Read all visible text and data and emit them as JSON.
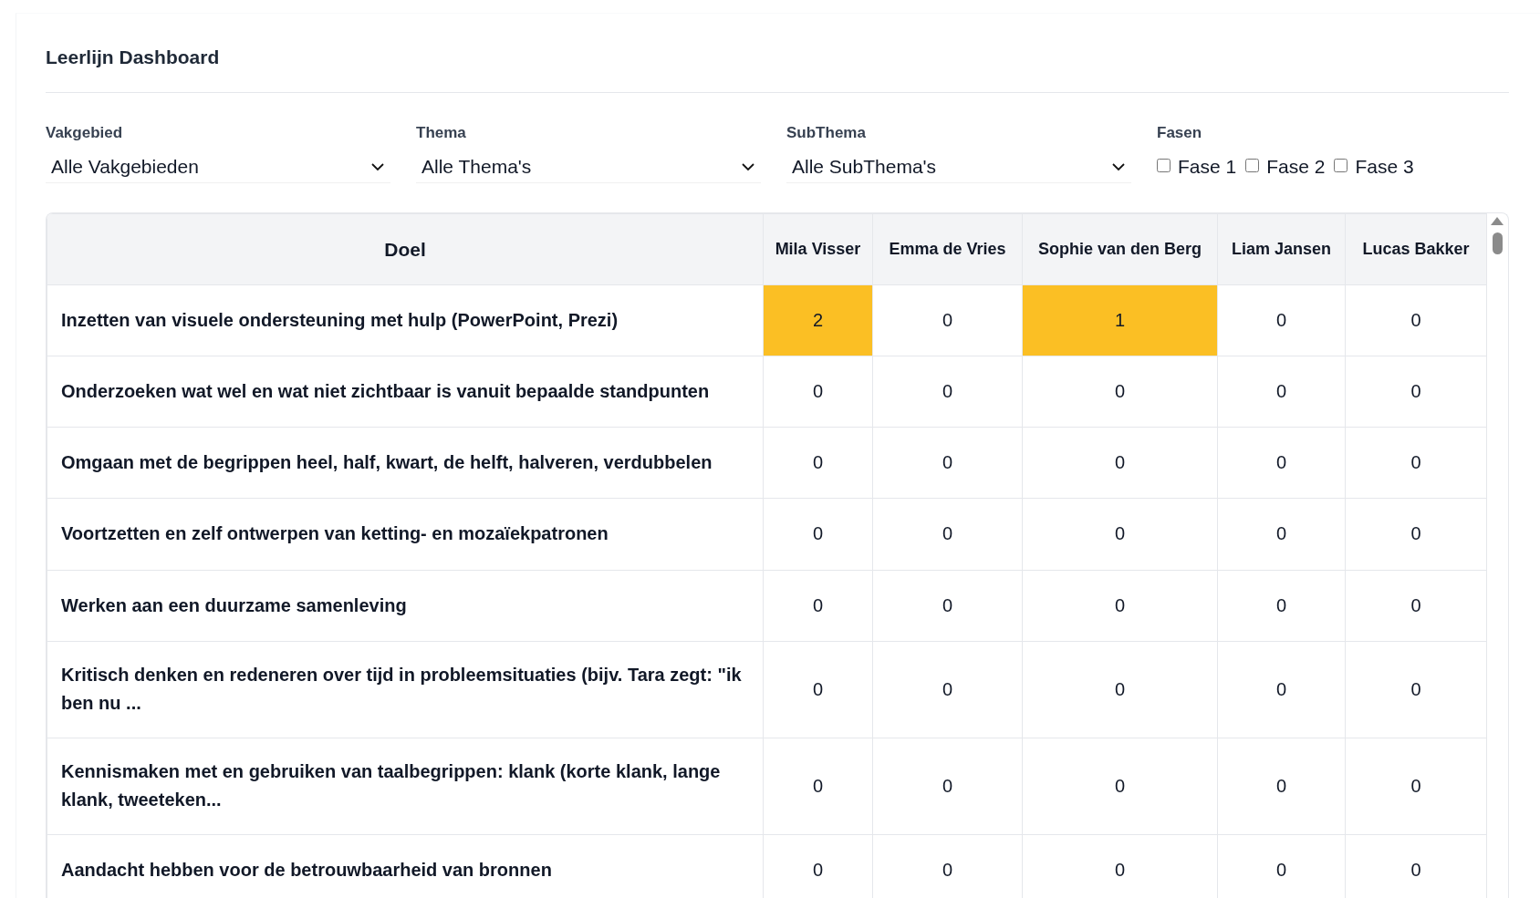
{
  "title": "Leerlijn Dashboard",
  "filters": [
    {
      "label": "Vakgebied",
      "value": "Alle Vakgebieden"
    },
    {
      "label": "Thema",
      "value": "Alle Thema's"
    },
    {
      "label": "SubThema",
      "value": "Alle SubThema's"
    }
  ],
  "phases": {
    "label": "Fasen",
    "options": [
      {
        "label": "Fase 1",
        "checked": false
      },
      {
        "label": "Fase 2",
        "checked": false
      },
      {
        "label": "Fase 3",
        "checked": false
      }
    ]
  },
  "table": {
    "columns": [
      "Doel",
      "Mila Visser",
      "Emma de Vries",
      "Sophie van den Berg",
      "Liam Jansen",
      "Lucas Bakker"
    ],
    "rows": [
      {
        "goal": "Inzetten van visuele ondersteuning met hulp (PowerPoint, Prezi)",
        "scores": [
          {
            "value": "2",
            "highlighted": true
          },
          {
            "value": "0",
            "highlighted": false
          },
          {
            "value": "1",
            "highlighted": true
          },
          {
            "value": "0",
            "highlighted": false
          },
          {
            "value": "0",
            "highlighted": false
          }
        ]
      },
      {
        "goal": "Onderzoeken wat wel en wat niet zichtbaar is vanuit bepaalde standpunten",
        "scores": [
          {
            "value": "0",
            "highlighted": false
          },
          {
            "value": "0",
            "highlighted": false
          },
          {
            "value": "0",
            "highlighted": false
          },
          {
            "value": "0",
            "highlighted": false
          },
          {
            "value": "0",
            "highlighted": false
          }
        ]
      },
      {
        "goal": "Omgaan met de begrippen heel, half, kwart, de helft, halveren, verdubbelen",
        "scores": [
          {
            "value": "0",
            "highlighted": false
          },
          {
            "value": "0",
            "highlighted": false
          },
          {
            "value": "0",
            "highlighted": false
          },
          {
            "value": "0",
            "highlighted": false
          },
          {
            "value": "0",
            "highlighted": false
          }
        ]
      },
      {
        "goal": "Voortzetten en zelf ontwerpen van ketting- en mozaïekpatronen",
        "scores": [
          {
            "value": "0",
            "highlighted": false
          },
          {
            "value": "0",
            "highlighted": false
          },
          {
            "value": "0",
            "highlighted": false
          },
          {
            "value": "0",
            "highlighted": false
          },
          {
            "value": "0",
            "highlighted": false
          }
        ]
      },
      {
        "goal": "Werken aan een duurzame samenleving",
        "scores": [
          {
            "value": "0",
            "highlighted": false
          },
          {
            "value": "0",
            "highlighted": false
          },
          {
            "value": "0",
            "highlighted": false
          },
          {
            "value": "0",
            "highlighted": false
          },
          {
            "value": "0",
            "highlighted": false
          }
        ]
      },
      {
        "goal": "Kritisch denken en redeneren over tijd in probleemsituaties (bijv. Tara zegt: \"ik ben nu ...",
        "scores": [
          {
            "value": "0",
            "highlighted": false
          },
          {
            "value": "0",
            "highlighted": false
          },
          {
            "value": "0",
            "highlighted": false
          },
          {
            "value": "0",
            "highlighted": false
          },
          {
            "value": "0",
            "highlighted": false
          }
        ]
      },
      {
        "goal": "Kennismaken met en gebruiken van taalbegrippen: klank (korte klank, lange klank, tweeteken...",
        "scores": [
          {
            "value": "0",
            "highlighted": false
          },
          {
            "value": "0",
            "highlighted": false
          },
          {
            "value": "0",
            "highlighted": false
          },
          {
            "value": "0",
            "highlighted": false
          },
          {
            "value": "0",
            "highlighted": false
          }
        ]
      },
      {
        "goal": "Aandacht hebben voor de betrouwbaarheid van bronnen",
        "scores": [
          {
            "value": "0",
            "highlighted": false
          },
          {
            "value": "0",
            "highlighted": false
          },
          {
            "value": "0",
            "highlighted": false
          },
          {
            "value": "0",
            "highlighted": false
          },
          {
            "value": "0",
            "highlighted": false
          }
        ]
      }
    ]
  }
}
